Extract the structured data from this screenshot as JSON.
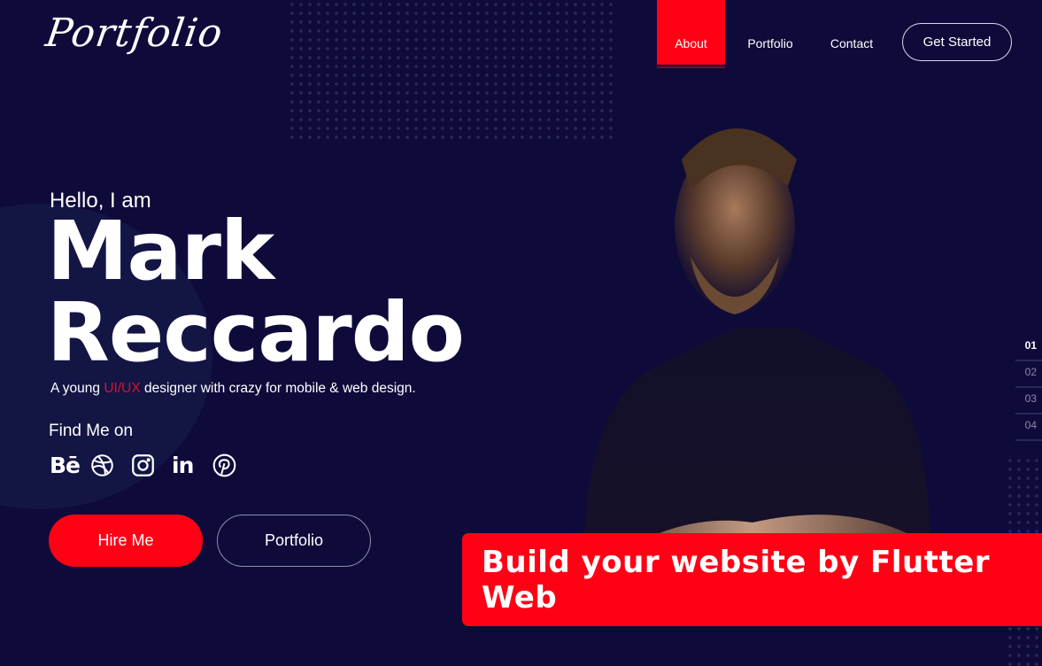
{
  "logo": "Portfolio",
  "nav": {
    "items": [
      {
        "label": "About",
        "active": true
      },
      {
        "label": "Portfolio",
        "active": false
      },
      {
        "label": "Contact",
        "active": false
      }
    ],
    "cta_label": "Get Started"
  },
  "hero": {
    "greeting": "Hello, I am",
    "first_name": "Mark",
    "last_name": "Reccardo",
    "tagline_prefix": "A young ",
    "tagline_highlight": "UI/UX",
    "tagline_suffix": " designer with crazy for mobile & web design.",
    "find_me_label": "Find Me on",
    "socials": [
      {
        "icon": "behance-icon",
        "label": "Bē"
      },
      {
        "icon": "dribbble-icon"
      },
      {
        "icon": "instagram-icon"
      },
      {
        "icon": "linkedin-icon",
        "label": "in"
      },
      {
        "icon": "pinterest-icon"
      }
    ],
    "hire_label": "Hire Me",
    "portfolio_label": "Portfolio"
  },
  "pager": [
    "01",
    "02",
    "03",
    "04"
  ],
  "pager_active_index": 0,
  "banner_text": "Build your website by Flutter Web",
  "colors": {
    "background": "#0e0b3b",
    "accent": "#ff0015",
    "highlight_text": "#e0102a"
  }
}
